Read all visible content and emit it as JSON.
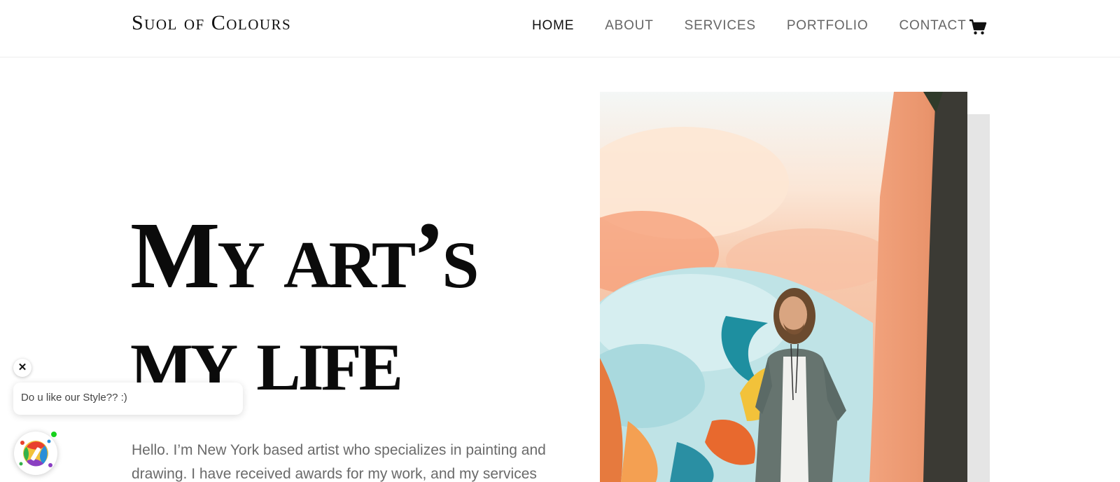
{
  "header": {
    "logo": "Suol of Colours",
    "nav": [
      {
        "label": "HOME",
        "active": true
      },
      {
        "label": "ABOUT",
        "active": false
      },
      {
        "label": "SERVICES",
        "active": false
      },
      {
        "label": "PORTFOLIO",
        "active": false
      },
      {
        "label": "CONTACT",
        "active": false
      }
    ],
    "cart_icon": "shopping-cart-icon"
  },
  "hero": {
    "title_line1": "My art’s",
    "title_line2": "my life",
    "body": "Hello. I’m New York based artist who specializes in painting and drawing. I have received awards for my work, and my services",
    "image": "artist standing before colorful painted wall"
  },
  "chat": {
    "close_label": "✕",
    "message": "Do u like our Style?? :)",
    "avatar_icon": "paint-splash-icon",
    "status_color": "#17d11c"
  }
}
